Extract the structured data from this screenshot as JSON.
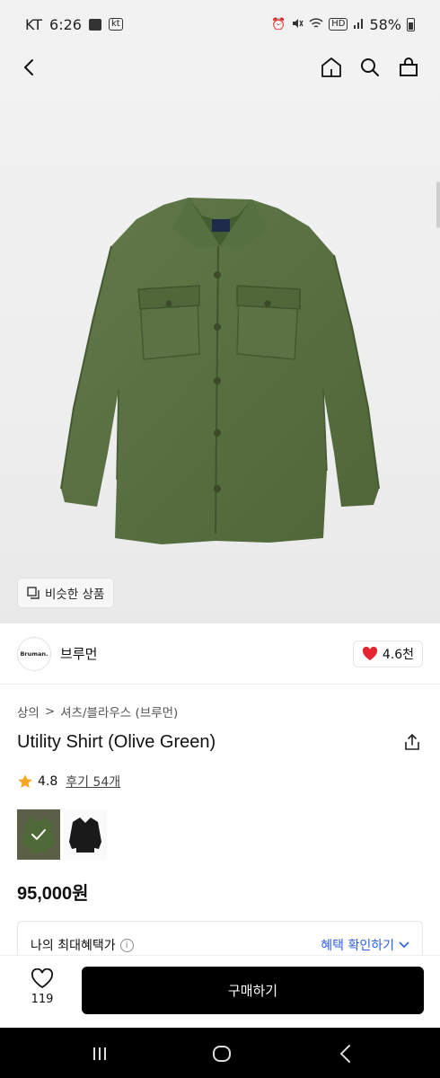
{
  "status_bar": {
    "carrier": "KT",
    "time": "6:26",
    "kt_badge": "kt",
    "battery": "58%",
    "icons": [
      "gallery-icon",
      "kt-icon",
      "alarm-icon",
      "mute-icon",
      "wifi-icon",
      "hd-icon",
      "signal-icon",
      "battery-icon"
    ]
  },
  "nav": {
    "icons": [
      "back-icon",
      "home-icon",
      "search-icon",
      "shopping-bag-icon"
    ]
  },
  "hero": {
    "similar_label": "비슷한 상품",
    "shirt_color": "#5a7242"
  },
  "brand": {
    "logo_text": "Bruman.",
    "name": "브루먼",
    "like_count": "4.6천",
    "heart_color": "#e5252f"
  },
  "breadcrumb": {
    "category": "상의",
    "separator": ">",
    "subcategory": "셔츠/블라우스 (브루먼)"
  },
  "product": {
    "title": "Utility Shirt (Olive Green)",
    "rating": "4.8",
    "review_label": "후기 54개",
    "price": "95,000원"
  },
  "swatches": [
    {
      "name": "Olive Green",
      "selected": true,
      "color": "#4f6a38"
    },
    {
      "name": "Black",
      "selected": false,
      "color": "#1a1a1a"
    }
  ],
  "benefit": {
    "label": "나의 최대혜택가",
    "link_label": "혜택 확인하기"
  },
  "action_bar": {
    "like_count": "119",
    "buy_label": "구매하기"
  },
  "android_nav": {
    "icons": [
      "recent-apps-icon",
      "home-circle-icon",
      "back-chevron-icon"
    ]
  },
  "colors": {
    "accent_link": "#2c5de5",
    "star": "#f5a623",
    "buy_button_bg": "#000000"
  }
}
